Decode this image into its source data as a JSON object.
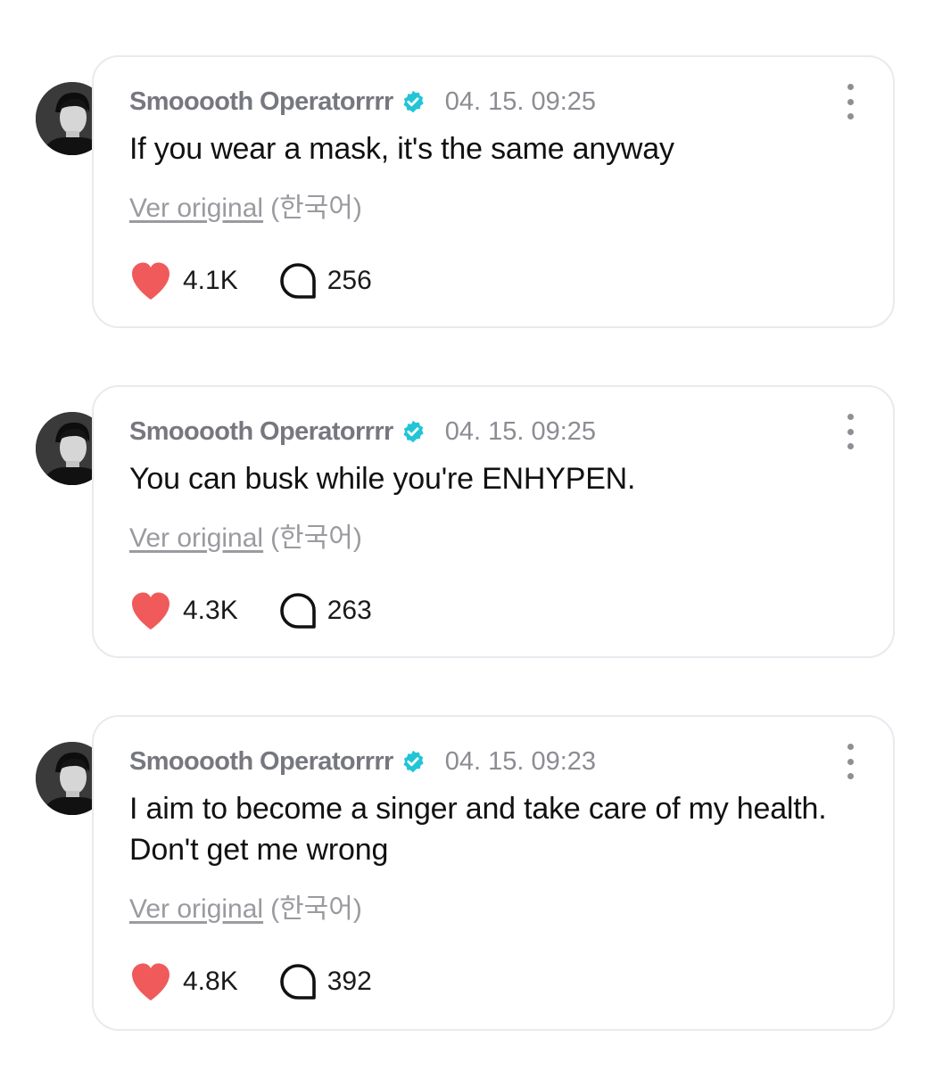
{
  "colors": {
    "heart": "#f05a5a",
    "verified_badge": "#21c5d6",
    "card_border": "#e9e9ef",
    "author_text": "#777780",
    "muted_text": "#9a9aa0",
    "body_text": "#111111"
  },
  "icons": {
    "like": "heart-icon",
    "comment": "speech-bubble-icon",
    "verified": "verified-badge-icon",
    "menu": "more-vertical-icon"
  },
  "posts": [
    {
      "author": "Smooooth Operatorrrr",
      "timestamp": "04. 15. 09:25",
      "text": "If you wear a mask, it's the same anyway",
      "translation_link": "Ver original",
      "translation_lang": "(한국어)",
      "likes": "4.1K",
      "comments": "256"
    },
    {
      "author": "Smooooth Operatorrrr",
      "timestamp": "04. 15. 09:25",
      "text": "You can busk while you're ENHYPEN.",
      "translation_link": "Ver original",
      "translation_lang": "(한국어)",
      "likes": "4.3K",
      "comments": "263"
    },
    {
      "author": "Smooooth Operatorrrr",
      "timestamp": "04. 15. 09:23",
      "text": "I aim to become a singer and take care of my health. Don't get me wrong",
      "translation_link": "Ver original",
      "translation_lang": "(한국어)",
      "likes": "4.8K",
      "comments": "392"
    }
  ]
}
